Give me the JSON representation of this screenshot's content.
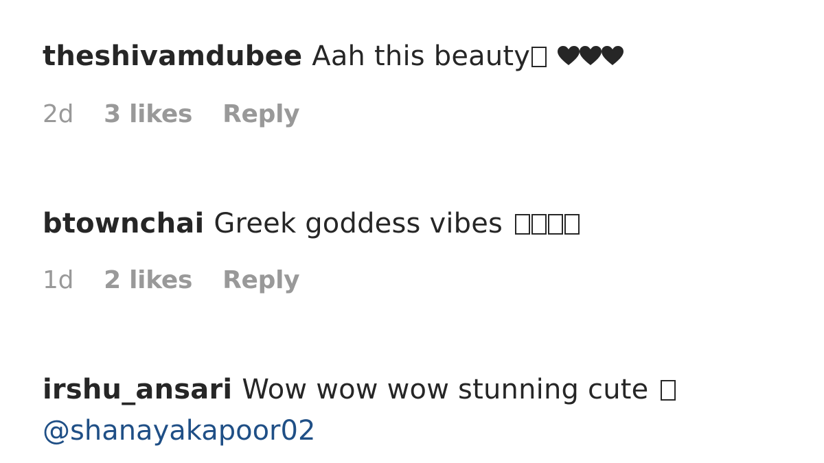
{
  "comments": [
    {
      "username": "theshivamdubee",
      "text": "Aah this beauty",
      "time": "2d",
      "likes": "3 likes",
      "reply": "Reply"
    },
    {
      "username": "btownchai",
      "text": "Greek goddess vibes",
      "time": "1d",
      "likes": "2 likes",
      "reply": "Reply"
    },
    {
      "username": "irshu_ansari",
      "text": "Wow wow wow stunning cute",
      "mention": "@shanayakapoor02"
    }
  ],
  "icons": {
    "heart": "heart-icon",
    "missing_glyph": "missing-glyph-icon"
  },
  "colors": {
    "text": "#262626",
    "meta": "#999999",
    "mention": "#1f4f86"
  }
}
